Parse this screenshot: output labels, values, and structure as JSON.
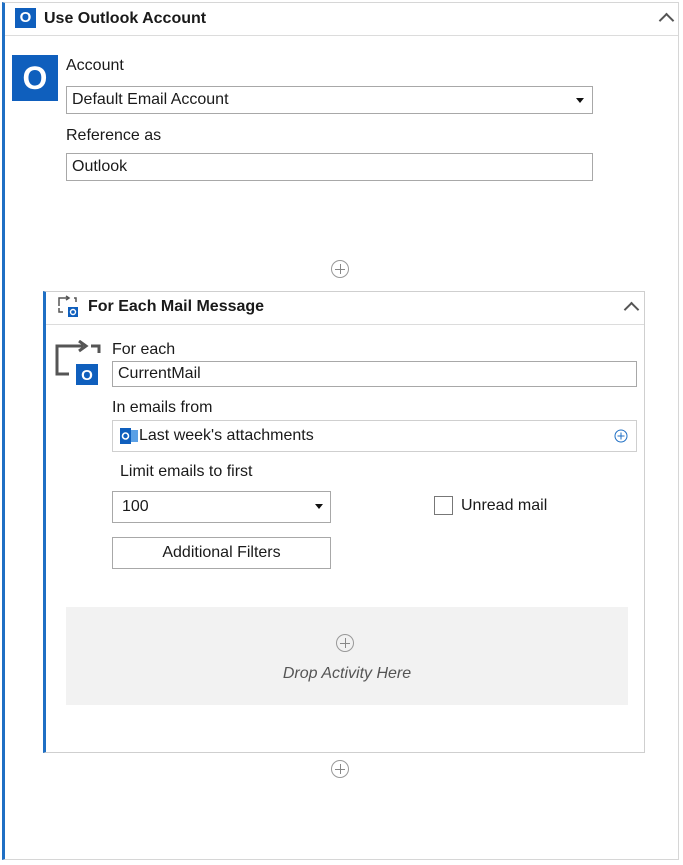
{
  "outer": {
    "title": "Use Outlook Account",
    "badge_letter": "O",
    "account_label": "Account",
    "account_value": "Default Email Account",
    "reference_label": "Reference as",
    "reference_value": "Outlook"
  },
  "inner": {
    "title": "For Each Mail Message",
    "badge_letter": "O",
    "for_each_label": "For each",
    "for_each_value": "CurrentMail",
    "in_emails_label": "In emails from",
    "in_emails_value": "Last week's attachments",
    "limit_label": "Limit emails to first",
    "limit_value": "100",
    "unread_label": "Unread mail",
    "unread_checked": false,
    "filters_button": "Additional Filters",
    "drop_text": "Drop Activity Here"
  },
  "colors": {
    "accent": "#1f6fc4",
    "badge": "#0f5fbd",
    "drop_bg": "#f2f2f2"
  },
  "icons": [
    "outlook-icon",
    "chevron-up-icon",
    "caret-down-icon",
    "add-circle-icon",
    "foreach-icon",
    "checkbox-icon"
  ]
}
